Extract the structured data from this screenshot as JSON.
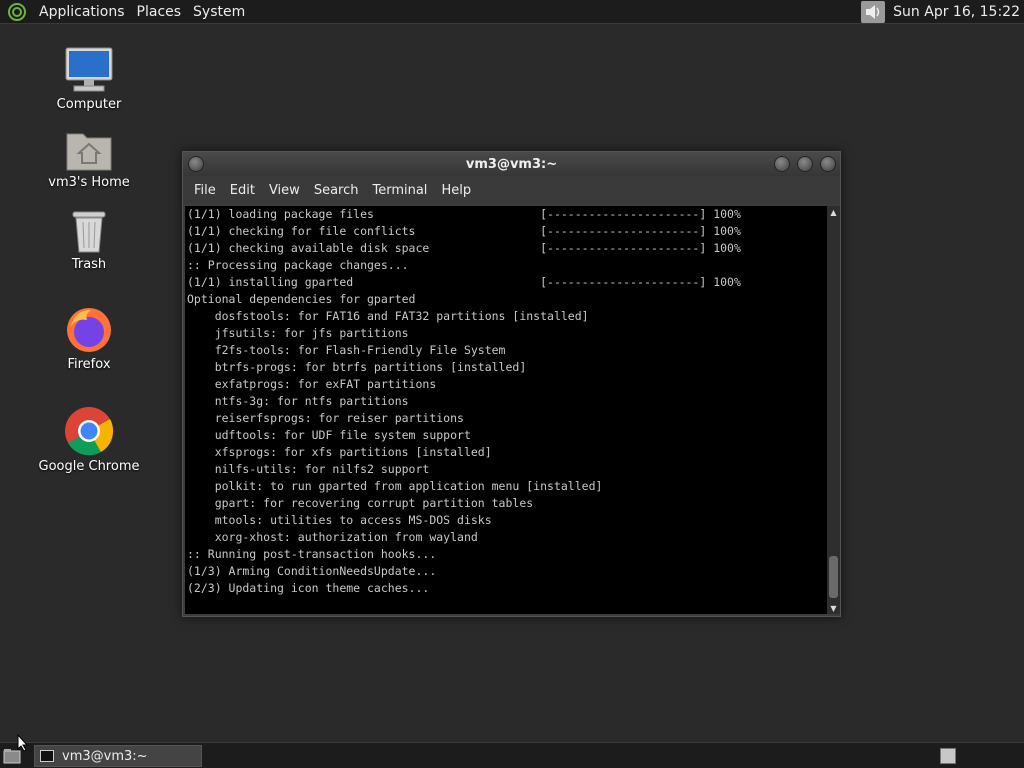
{
  "top_panel": {
    "menus": [
      "Applications",
      "Places",
      "System"
    ],
    "clock": "Sun Apr 16, 15:22"
  },
  "desktop_icons": [
    {
      "label": "Computer",
      "icon": "computer-icon"
    },
    {
      "label": "vm3's Home",
      "icon": "home-folder-icon"
    },
    {
      "label": "Trash",
      "icon": "trash-icon"
    },
    {
      "label": "Firefox",
      "icon": "firefox-icon"
    },
    {
      "label": "Google Chrome",
      "icon": "chrome-icon"
    }
  ],
  "terminal": {
    "title": "vm3@vm3:~",
    "menu": [
      "File",
      "Edit",
      "View",
      "Search",
      "Terminal",
      "Help"
    ],
    "lines": [
      "(1/1) loading package files                        [----------------------] 100%",
      "(1/1) checking for file conflicts                  [----------------------] 100%",
      "(1/1) checking available disk space                [----------------------] 100%",
      ":: Processing package changes...",
      "(1/1) installing gparted                           [----------------------] 100%",
      "Optional dependencies for gparted",
      "    dosfstools: for FAT16 and FAT32 partitions [installed]",
      "    jfsutils: for jfs partitions",
      "    f2fs-tools: for Flash-Friendly File System",
      "    btrfs-progs: for btrfs partitions [installed]",
      "    exfatprogs: for exFAT partitions",
      "    ntfs-3g: for ntfs partitions",
      "    reiserfsprogs: for reiser partitions",
      "    udftools: for UDF file system support",
      "    xfsprogs: for xfs partitions [installed]",
      "    nilfs-utils: for nilfs2 support",
      "    polkit: to run gparted from application menu [installed]",
      "    gpart: for recovering corrupt partition tables",
      "    mtools: utilities to access MS-DOS disks",
      "    xorg-xhost: authorization from wayland",
      ":: Running post-transaction hooks...",
      "(1/3) Arming ConditionNeedsUpdate...",
      "(2/3) Updating icon theme caches..."
    ]
  },
  "taskbar": {
    "task_label": "vm3@vm3:~"
  }
}
